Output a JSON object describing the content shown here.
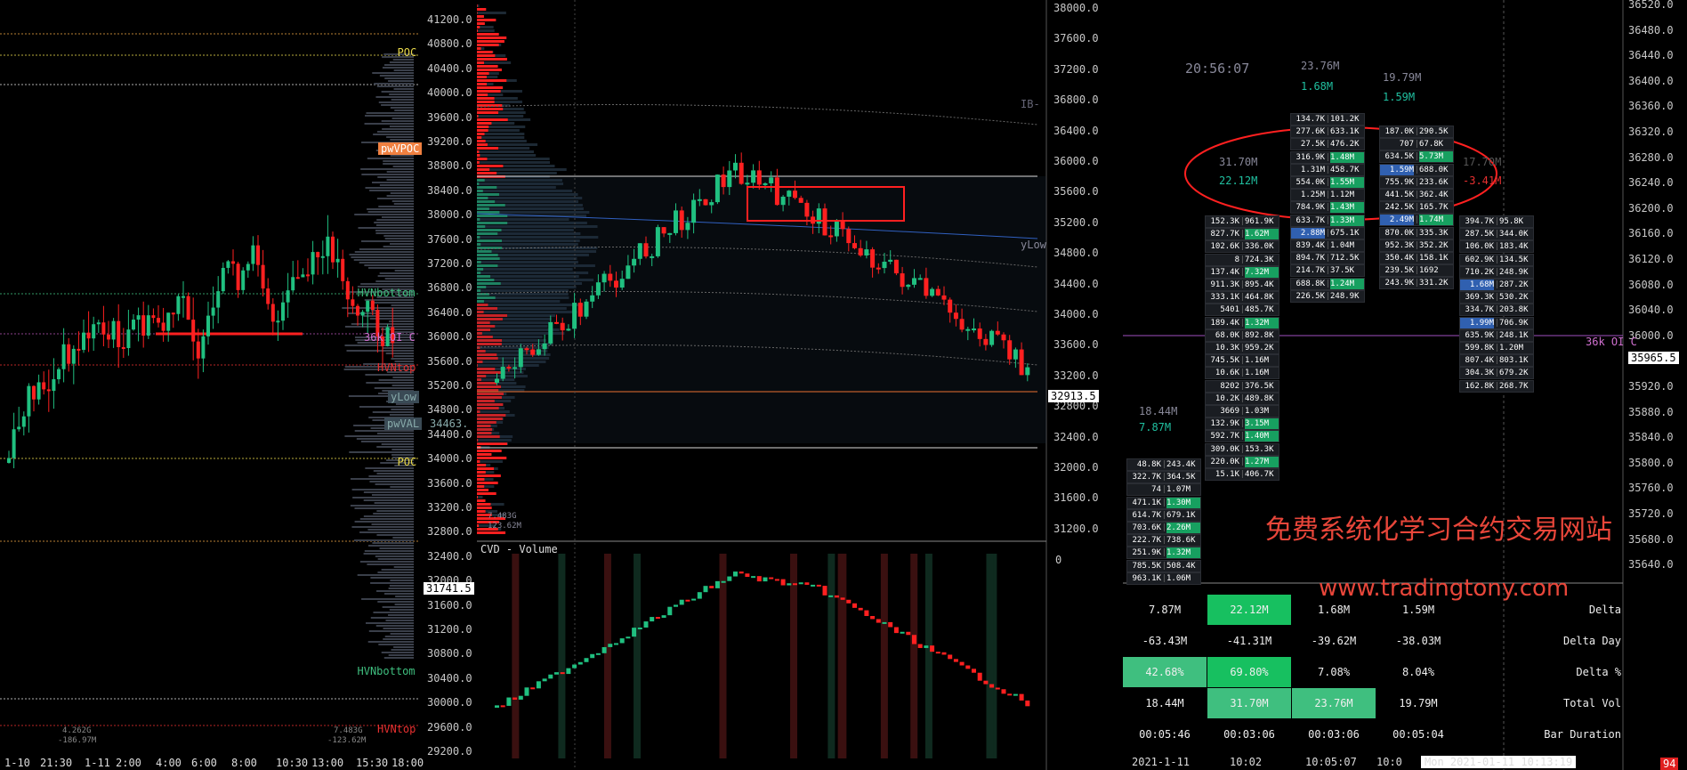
{
  "left_panel": {
    "price_axis": [
      "41200.0",
      "40800.0",
      "40400.0",
      "40000.0",
      "39600.0",
      "39200.0",
      "38800.0",
      "38400.0",
      "38000.0",
      "37600.0",
      "37200.0",
      "36800.0",
      "36400.0",
      "36000.0",
      "35600.0",
      "35200.0",
      "34800.0",
      "34400.0",
      "34000.0",
      "33600.0",
      "33200.0",
      "32800.0",
      "32400.0",
      "32000.0",
      "31600.0",
      "31200.0",
      "30800.0",
      "30400.0",
      "30000.0",
      "29600.0",
      "29200.0"
    ],
    "time_axis": [
      "1-10",
      "21:30",
      "1-11",
      "2:00",
      "4:00",
      "6:00",
      "8:00",
      "10:30",
      "13:00",
      "15:30",
      "18:00"
    ],
    "level_tags": [
      {
        "text": "POC",
        "color": "#e8d84a"
      },
      {
        "text": "pwVPOC",
        "color": "#fff"
      },
      {
        "text": "HVNbottom",
        "color": "#3fbf7f"
      },
      {
        "text": "36k OI C",
        "color": "#d070d0"
      },
      {
        "text": "HVNtop",
        "color": "#e83030"
      },
      {
        "text": "yLow",
        "color": "#8aa"
      },
      {
        "text": "pwVAL",
        "color": "#8aa"
      },
      {
        "text": "34463.",
        "color": "#8aa"
      },
      {
        "text": "POC",
        "color": "#e8d84a"
      },
      {
        "text": "HVNbottom",
        "color": "#3fbf7f"
      },
      {
        "text": "HVNtop",
        "color": "#e83030"
      }
    ],
    "current_price": "31741.5",
    "footer_small": [
      "4.262G",
      "-186.97M",
      "7.483G",
      "-123.62M"
    ]
  },
  "middle_panel": {
    "price_axis": [
      "38000.0",
      "37600.0",
      "37200.0",
      "36800.0",
      "36400.0",
      "36000.0",
      "35600.0",
      "35200.0",
      "34800.0",
      "34400.0",
      "34000.0",
      "33600.0",
      "33200.0",
      "32800.0",
      "32400.0",
      "32000.0",
      "31600.0",
      "31200.0"
    ],
    "current_price": "32913.5",
    "tags": [
      "IB-",
      "yLow"
    ],
    "profile_footer": [
      "7.483G",
      "123.62M"
    ],
    "cvd_title": "CVD - Volume",
    "cvd_axis_zero": "0"
  },
  "right_panel": {
    "price_axis": [
      "36520.0",
      "36480.0",
      "36440.0",
      "36400.0",
      "36360.0",
      "36320.0",
      "36280.0",
      "36240.0",
      "36200.0",
      "36160.0",
      "36120.0",
      "36080.0",
      "36040.0",
      "36000.0",
      "35960.0",
      "35920.0",
      "35880.0",
      "35840.0",
      "35800.0",
      "35760.0",
      "35720.0",
      "35680.0",
      "35640.0"
    ],
    "current_price": "35965.5",
    "oi_tag": "36k OI C",
    "clock": "20:56:07",
    "bar_headers": [
      {
        "vol": "18.44M",
        "delta": "7.87M"
      },
      {
        "vol": "31.70M",
        "delta": "22.12M"
      },
      {
        "vol": "23.76M",
        "delta": "1.68M"
      },
      {
        "vol": "19.79M",
        "delta": "1.59M"
      },
      {
        "vol": "17.70M",
        "delta": "-3.41M"
      }
    ],
    "footprints": [
      {
        "rows": [
          [
            "48.8K",
            "243.4K"
          ],
          [
            "322.7K",
            "364.5K"
          ],
          [
            "74",
            "1.07M"
          ],
          [
            "471.1K",
            "1.30M"
          ],
          [
            "614.7K",
            "679.1K"
          ],
          [
            "703.6K",
            "2.26M"
          ],
          [
            "222.7K",
            "738.6K"
          ],
          [
            "251.9K",
            "1.32M"
          ],
          [
            "785.5K",
            "508.4K"
          ],
          [
            "963.1K",
            "1.06M"
          ]
        ]
      },
      {
        "rows": [
          [
            "152.3K",
            "961.9K"
          ],
          [
            "827.7K",
            "1.62M"
          ],
          [
            "102.6K",
            "336.0K"
          ],
          [
            "8",
            "724.3K"
          ],
          [
            "137.4K",
            "7.32M"
          ],
          [
            "911.3K",
            "895.4K"
          ],
          [
            "333.1K",
            "464.8K"
          ],
          [
            "5401",
            "485.7K"
          ],
          [
            "189.4K",
            "1.32M"
          ],
          [
            "68.0K",
            "892.8K"
          ],
          [
            "10.3K",
            "959.2K"
          ],
          [
            "745.5K",
            "1.16M"
          ],
          [
            "10.6K",
            "1.16M"
          ],
          [
            "8202",
            "376.5K"
          ],
          [
            "10.2K",
            "489.8K"
          ],
          [
            "3669",
            "1.03M"
          ],
          [
            "132.9K",
            "3.15M"
          ],
          [
            "592.7K",
            "1.40M"
          ],
          [
            "309.0K",
            "153.3K"
          ],
          [
            "220.0K",
            "1.27M"
          ],
          [
            "15.1K",
            "406.7K"
          ]
        ]
      },
      {
        "rows": [
          [
            "134.7K",
            "101.2K"
          ],
          [
            "277.6K",
            "633.1K"
          ],
          [
            "27.5K",
            "476.2K"
          ],
          [
            "316.9K",
            "1.48M"
          ],
          [
            "1.31M",
            "458.7K"
          ],
          [
            "554.0K",
            "1.55M"
          ],
          [
            "1.25M",
            "1.12M"
          ],
          [
            "784.9K",
            "1.43M"
          ],
          [
            "633.7K",
            "1.33M"
          ],
          [
            "2.88M",
            "675.1K"
          ],
          [
            "839.4K",
            "1.04M"
          ],
          [
            "894.7K",
            "712.5K"
          ],
          [
            "214.7K",
            "37.5K"
          ],
          [
            "688.8K",
            "1.24M"
          ],
          [
            "226.5K",
            "248.9K"
          ]
        ]
      },
      {
        "rows": [
          [
            "187.0K",
            "290.5K"
          ],
          [
            "707",
            "67.8K"
          ],
          [
            "634.5K",
            "5.73M"
          ],
          [
            "1.59M",
            "688.0K"
          ],
          [
            "755.9K",
            "233.6K"
          ],
          [
            "441.5K",
            "362.4K"
          ],
          [
            "242.5K",
            "165.7K"
          ],
          [
            "2.49M",
            "1.74M"
          ],
          [
            "870.0K",
            "335.3K"
          ],
          [
            "952.3K",
            "352.2K"
          ],
          [
            "350.4K",
            "158.1K"
          ],
          [
            "239.5K",
            "1692"
          ],
          [
            "243.9K",
            "331.2K"
          ]
        ]
      },
      {
        "rows": [
          [
            "394.7K",
            "95.8K"
          ],
          [
            "287.5K",
            "344.0K"
          ],
          [
            "106.0K",
            "183.4K"
          ],
          [
            "602.9K",
            "134.5K"
          ],
          [
            "710.2K",
            "248.9K"
          ],
          [
            "1.68M",
            "287.2K"
          ],
          [
            "369.3K",
            "530.2K"
          ],
          [
            "334.7K",
            "203.8K"
          ],
          [
            "1.99M",
            "706.9K"
          ],
          [
            "635.9K",
            "248.1K"
          ],
          [
            "599.8K",
            "1.20M"
          ],
          [
            "807.4K",
            "803.1K"
          ],
          [
            "304.3K",
            "679.2K"
          ],
          [
            "162.8K",
            "268.7K"
          ]
        ]
      }
    ],
    "stats": {
      "labels": [
        "Delta",
        "Delta Day",
        "Delta %",
        "Total Vol",
        "Bar Duration"
      ],
      "columns": [
        [
          "7.87M",
          "-63.43M",
          "42.68%",
          "18.44M",
          "00:05:46"
        ],
        [
          "22.12M",
          "-41.31M",
          "69.80%",
          "31.70M",
          "00:03:06"
        ],
        [
          "1.68M",
          "-39.62M",
          "7.08%",
          "23.76M",
          "00:03:06"
        ],
        [
          "1.59M",
          "-38.03M",
          "8.04%",
          "19.79M",
          "00:05:04"
        ]
      ]
    },
    "time_axis": [
      "2021-1-11",
      "10:02",
      "10:05:07",
      "10:0",
      "Mon 2021-01-11  10:13:19"
    ],
    "corner_badge": "94",
    "watermark_cn": "免费系统化学习合约交易网站",
    "watermark_url": "www.tradingtony.com"
  }
}
